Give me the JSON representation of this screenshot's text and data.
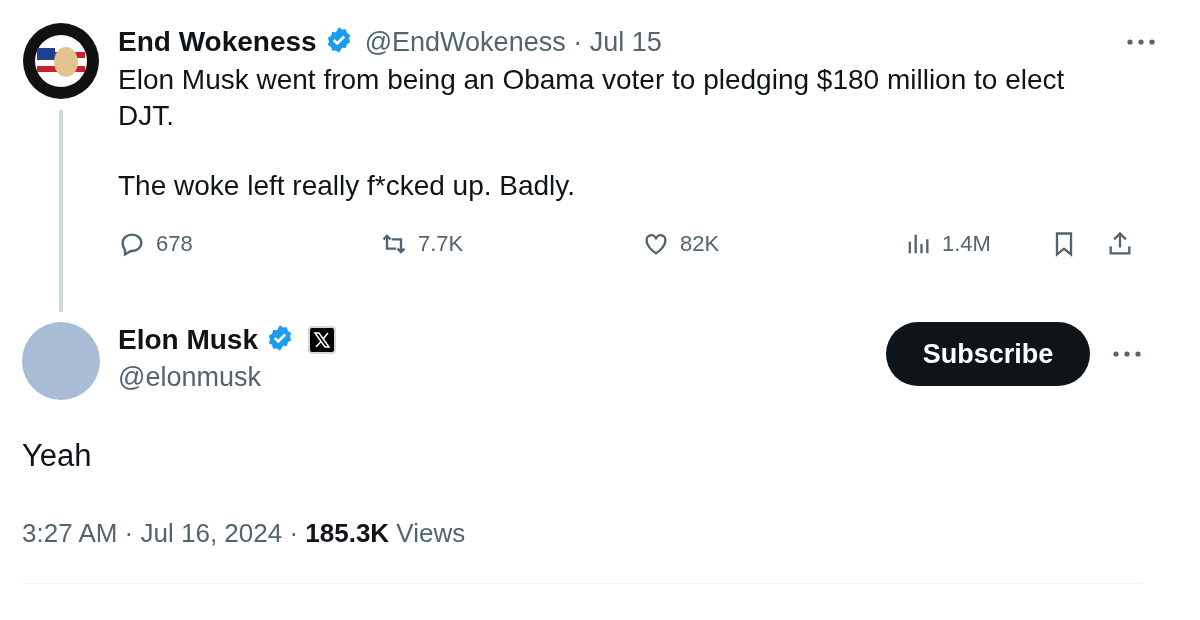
{
  "quoted_tweet": {
    "author_name": "End Wokeness",
    "verified": true,
    "meta": "@EndWokeness · Jul 15",
    "paragraphs": [
      "Elon Musk went from being an Obama voter to pledging $180 million to elect DJT.",
      "The woke left really f*cked up. Badly."
    ],
    "actions": [
      {
        "kind": "reply",
        "count": "678"
      },
      {
        "kind": "repost",
        "count": "7.7K"
      },
      {
        "kind": "like",
        "count": "82K"
      },
      {
        "kind": "views",
        "count": "1.4M"
      },
      {
        "kind": "bookmark"
      },
      {
        "kind": "share"
      }
    ]
  },
  "tweet": {
    "author_name": "Elon Musk",
    "verified": true,
    "affiliate_badge": true,
    "handle": "@elonmusk",
    "subscribe_label": "Subscribe",
    "text": "Yeah",
    "timestamp": "3:27 AM · Jul 16, 2024 · **185.3K** Views"
  }
}
